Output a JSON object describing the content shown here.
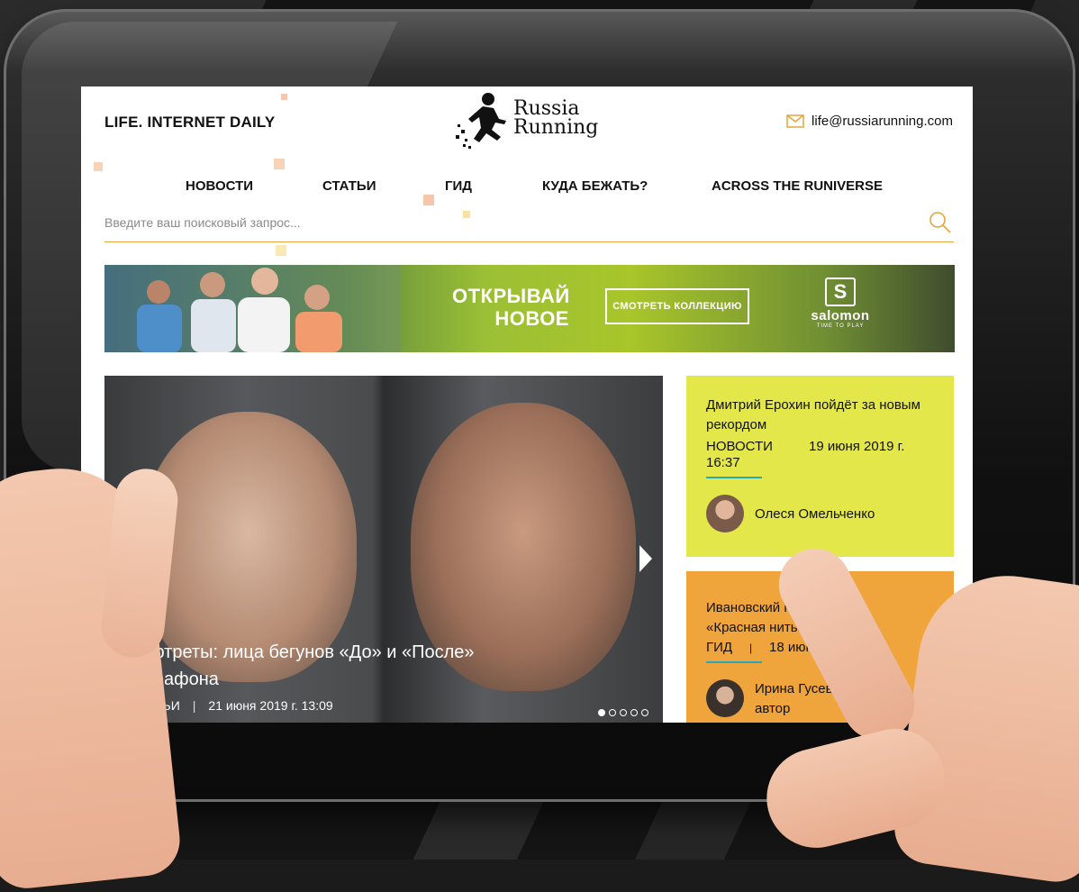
{
  "header": {
    "tagline": "LIFE. INTERNET DAILY",
    "logo_line1": "Russia",
    "logo_line2": "Running",
    "email": "life@russiarunning.com"
  },
  "nav": {
    "items": [
      "НОВОСТИ",
      "СТАТЬИ",
      "ГИД",
      "КУДА БЕЖАТЬ?",
      "ACROSS THE RUNIVERSE"
    ]
  },
  "search": {
    "placeholder": "Введите ваш поисковый запрос..."
  },
  "banner": {
    "title_line1": "ОТКРЫВАЙ",
    "title_line2": "НОВОЕ",
    "button_label": "СМОТРЕТЬ КОЛЛЕКЦИЮ",
    "brand_name": "salomon",
    "brand_tagline": "TIME TO PLAY"
  },
  "hero": {
    "title": "Портреты: лица бегунов «До» и «После» марафона",
    "category": "СТАТЬИ",
    "separator": "|",
    "date": "21 июня 2019 г. 13:09",
    "slides_total": 5,
    "active_slide": 1
  },
  "cards": [
    {
      "title": "Дмитрий Ерохин пойдёт за новым рекордом",
      "category": "НОВОСТИ",
      "date": "19 июня 2019 г.",
      "time": "16:37",
      "author": "Олеся Омельченко",
      "bg": "#e3e74a"
    },
    {
      "title": "Ивановский полум «Красная нить»",
      "category": "ГИД",
      "separator": "|",
      "date": "18 июня 2019",
      "author": "Ирина Гусева",
      "author_role": "автор",
      "bg": "#f0a43c"
    }
  ],
  "colors": {
    "accent_orange": "#e7a33c",
    "accent_teal": "#27a7b8",
    "card_yellow": "#e3e74a",
    "card_orange": "#f0a43c"
  },
  "icons": {
    "email": "envelope-icon",
    "search": "search-icon",
    "next": "arrow-right-icon"
  }
}
